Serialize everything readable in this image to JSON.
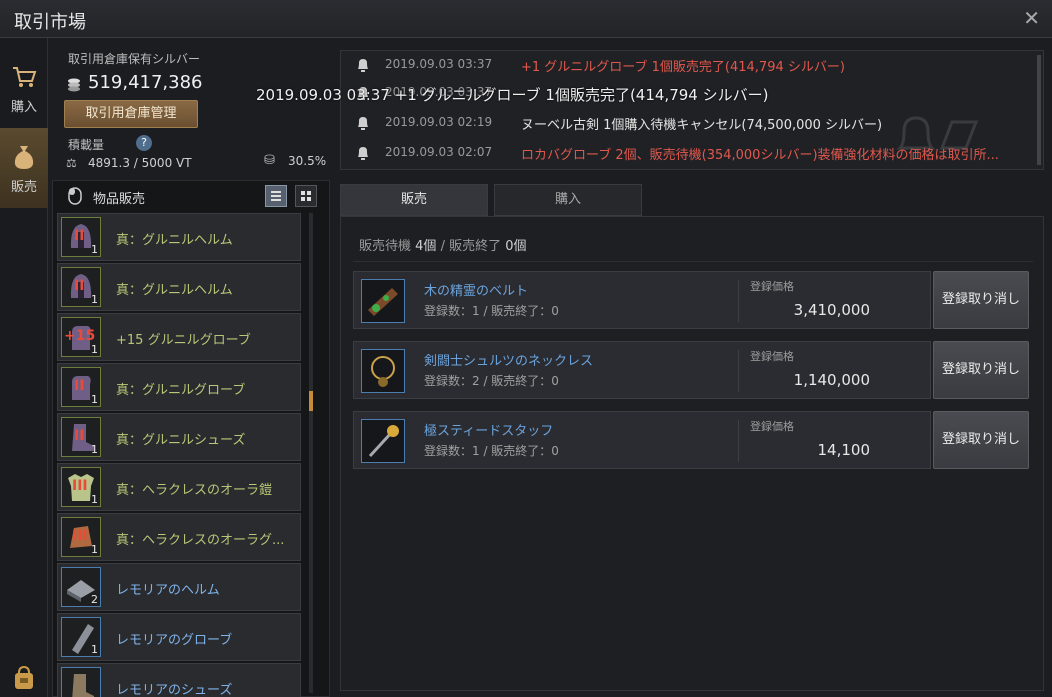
{
  "window": {
    "title": "取引市場"
  },
  "nav": {
    "buy_label": "購入",
    "sell_label": "販売"
  },
  "silver": {
    "label": "取引用倉庫保有シルバー",
    "amount": "519,417,386",
    "manage_button": "取引用倉庫管理"
  },
  "weight": {
    "label": "積載量",
    "value": "4891.3 / 5000 VT",
    "percent": "30.5%"
  },
  "item_list": {
    "title": "物品販売",
    "items": [
      {
        "name": "真：グルニルヘルム",
        "qty": "1",
        "color": "green",
        "mark": "II"
      },
      {
        "name": "真：グルニルヘルム",
        "qty": "1",
        "color": "green",
        "mark": "II"
      },
      {
        "name": "+15 グルニルグローブ",
        "qty": "1",
        "color": "green",
        "mark": "+15"
      },
      {
        "name": "真：グルニルグローブ",
        "qty": "1",
        "color": "green",
        "mark": "II"
      },
      {
        "name": "真：グルニルシューズ",
        "qty": "1",
        "color": "green",
        "mark": "II"
      },
      {
        "name": "真：ヘラクレスのオーラ鎧",
        "qty": "1",
        "color": "green",
        "mark": "III"
      },
      {
        "name": "真：ヘラクレスのオーラグ...",
        "qty": "1",
        "color": "green",
        "mark": "III"
      },
      {
        "name": "レモリアのヘルム",
        "qty": "2",
        "color": "blue",
        "mark": ""
      },
      {
        "name": "レモリアのグローブ",
        "qty": "1",
        "color": "blue",
        "mark": ""
      },
      {
        "name": "レモリアのシューズ",
        "qty": "",
        "color": "blue",
        "mark": ""
      }
    ]
  },
  "notifications": [
    {
      "time": "2019.09.03 03:37",
      "message": "+1 グルニルグローブ 1個販売完了(414,794 シルバー)",
      "color": "red"
    },
    {
      "time": "2019.09.03 03:37",
      "message": "",
      "color": "white"
    },
    {
      "time": "2019.09.03 02:19",
      "message": "ヌーベル古剣 1個購入待機キャンセル(74,500,000 シルバー)",
      "color": "white"
    },
    {
      "time": "2019.09.03 02:07",
      "message": "ロカバグローブ 2個、販売待機(354,000シルバー)装備強化材料の価格は取引所...",
      "color": "red"
    }
  ],
  "overlay_text": "2019.09.03 03:37 +1 グルニルグローブ 1個販売完了(414,794 シルバー)",
  "tabs": {
    "sell": "販売",
    "buy": "購入"
  },
  "status": {
    "waiting_label": "販売待機",
    "waiting_count": "4個",
    "separator": "/",
    "done_label": "販売終了",
    "done_count": "0個"
  },
  "sales": [
    {
      "name": "木の精霊のベルト",
      "count": "登録数：1 / 販売終了：0",
      "price_label": "登録価格",
      "price": "3,410,000",
      "cancel": "登録取り消し"
    },
    {
      "name": "剣闘士シュルツのネックレス",
      "count": "登録数：2 / 販売終了：0",
      "price_label": "登録価格",
      "price": "1,140,000",
      "cancel": "登録取り消し"
    },
    {
      "name": "極スティードスタッフ",
      "count": "登録数：1 / 販売終了：0",
      "price_label": "登録価格",
      "price": "14,100",
      "cancel": "登録取り消し"
    }
  ],
  "colors": {
    "accent": "#c68a3a",
    "red_text": "#e0584d",
    "blue_text": "#6aa3dc",
    "green_text": "#b6c877"
  }
}
